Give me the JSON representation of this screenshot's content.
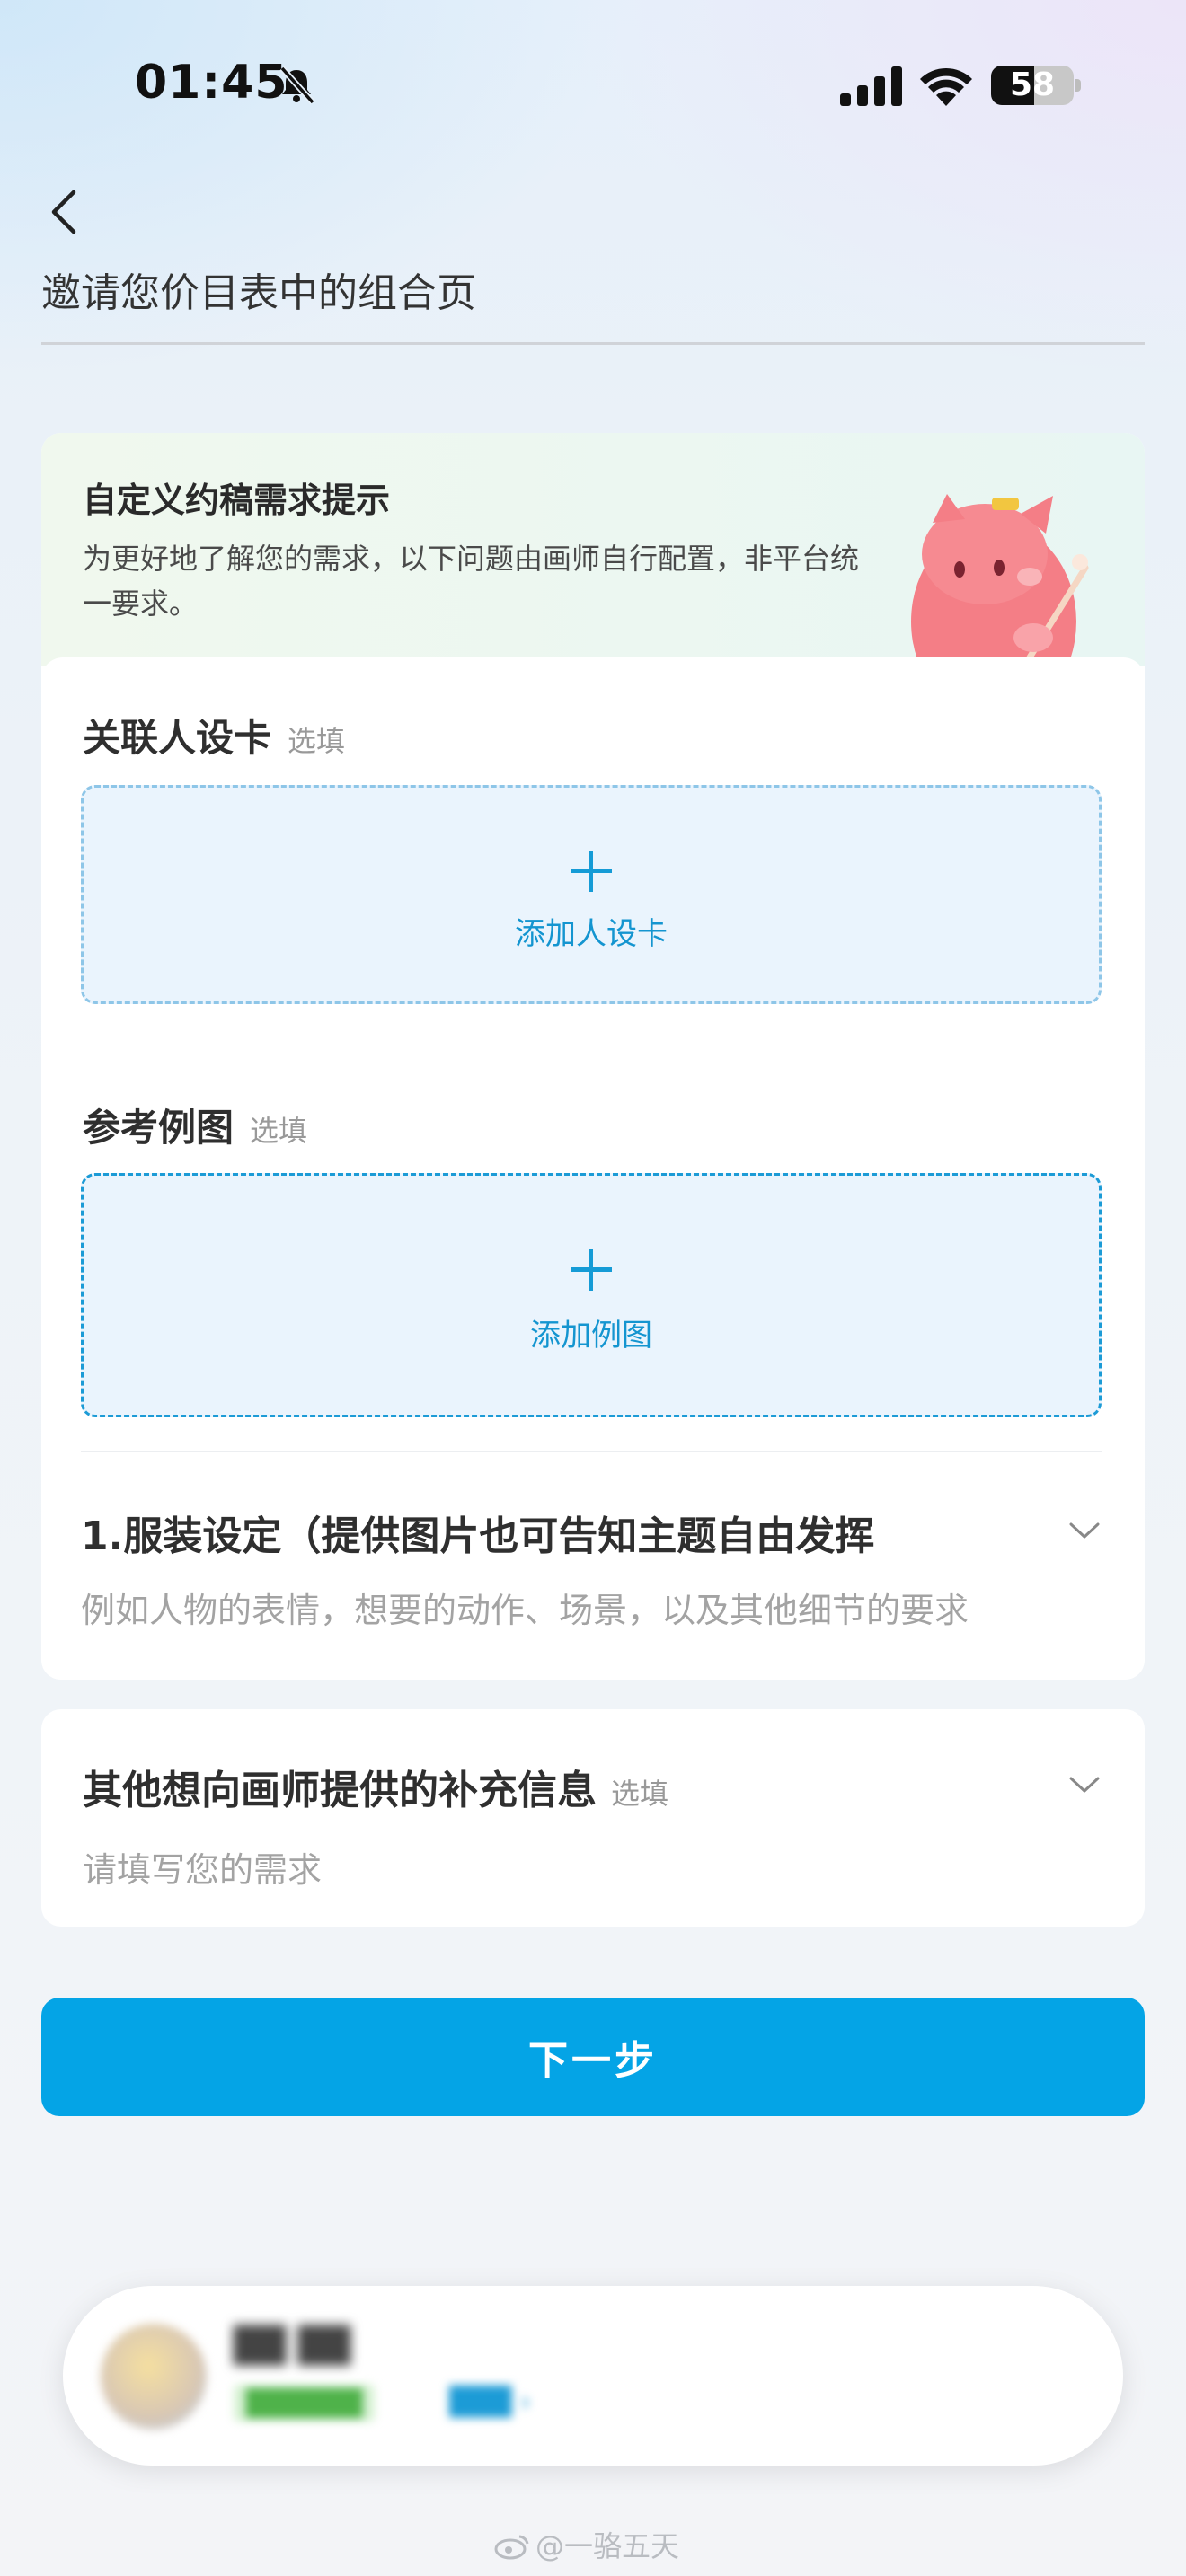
{
  "status_bar": {
    "time": "01:45",
    "battery": "58"
  },
  "header": {
    "title": "邀请您价目表中的组合页"
  },
  "tip": {
    "title": "自定义约稿需求提示",
    "description": "为更好地了解您的需求，以下问题由画师自行配置，非平台统一要求。"
  },
  "character_card": {
    "label": "关联人设卡",
    "optional": "选填",
    "add_label": "添加人设卡"
  },
  "reference": {
    "label": "参考例图",
    "optional": "选填",
    "add_label": "添加例图"
  },
  "question1": {
    "title": "1.服装设定（提供图片也可告知主题自由发挥",
    "hint": "例如人物的表情，想要的动作、场景，以及其他细节的要求"
  },
  "extra_info": {
    "title": "其他想向画师提供的补充信息",
    "optional": "选填",
    "hint": "请填写您的需求"
  },
  "next_button": "下一步",
  "watermark": "@一骆五天",
  "colors": {
    "accent": "#04a4e6",
    "upload_bg": "#eaf4fd",
    "tip_bg": "#ecf7f1"
  }
}
